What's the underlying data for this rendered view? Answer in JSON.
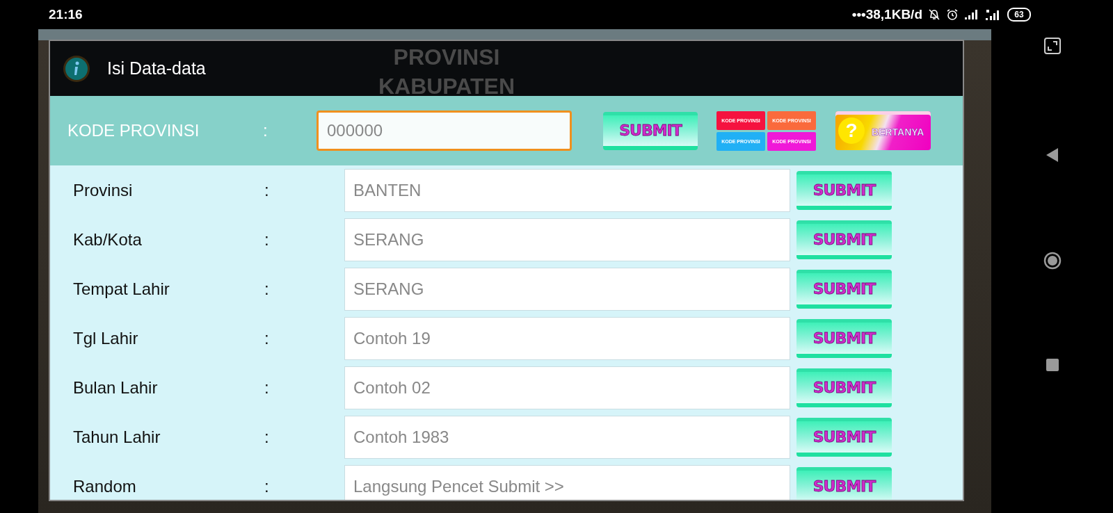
{
  "status_bar": {
    "time": "21:16",
    "network_speed": "•••38,1KB/d",
    "battery": "63"
  },
  "background": {
    "headings": [
      "PROVINSI",
      "KABUPATEN"
    ]
  },
  "dialog": {
    "title": "Isi Data-data",
    "header": {
      "label": "KODE PROVINSI",
      "colon": ":",
      "input": {
        "placeholder": "000000",
        "focused": true
      },
      "submit": "SUBMIT",
      "code_buttons": [
        {
          "label": "KODE PROVINSI",
          "color": "#f5123f"
        },
        {
          "label": "KODE PROVINSI",
          "color": "#fa6a3c"
        },
        {
          "label": "KODE PROVINSI",
          "color": "#21b0f5"
        },
        {
          "label": "KODE PROVINSI",
          "color": "#f018d8"
        }
      ],
      "ask_button": {
        "mark": "?",
        "label": "BERTANYA"
      }
    },
    "rows": [
      {
        "label": "Provinsi",
        "colon": ":",
        "value": "BANTEN",
        "submit": "SUBMIT"
      },
      {
        "label": "Kab/Kota",
        "colon": ":",
        "value": "SERANG",
        "submit": "SUBMIT"
      },
      {
        "label": "Tempat Lahir",
        "colon": ":",
        "value": "SERANG",
        "submit": "SUBMIT"
      },
      {
        "label": "Tgl Lahir",
        "colon": ":",
        "placeholder": "Contoh 19",
        "submit": "SUBMIT"
      },
      {
        "label": "Bulan Lahir",
        "colon": ":",
        "placeholder": "Contoh 02",
        "submit": "SUBMIT"
      },
      {
        "label": "Tahun Lahir",
        "colon": ":",
        "placeholder": "Contoh 1983",
        "submit": "SUBMIT"
      },
      {
        "label": "Random",
        "colon": ":",
        "placeholder": "Langsung Pencet Submit >>",
        "submit": "SUBMIT"
      }
    ]
  }
}
